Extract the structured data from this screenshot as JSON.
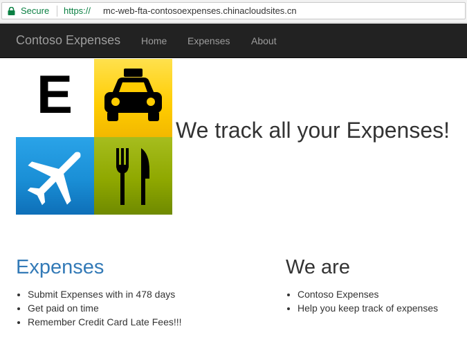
{
  "browser": {
    "secure_label": "Secure",
    "url_scheme": "https://",
    "url_host": "mc-web-fta-contosoexpenses.chinacloudsites.cn",
    "secure_color": "#0b8043"
  },
  "navbar": {
    "brand": "Contoso Expenses",
    "links": [
      {
        "label": "Home"
      },
      {
        "label": "Expenses"
      },
      {
        "label": "About"
      }
    ],
    "background": "#222222"
  },
  "hero": {
    "logo_letter": "E",
    "tiles": [
      {
        "icon": "letter-e-icon",
        "color": "#ffffff"
      },
      {
        "icon": "taxi-icon",
        "color": "#ffcc00"
      },
      {
        "icon": "airplane-icon",
        "color": "#1a8fd6"
      },
      {
        "icon": "fork-knife-icon",
        "color": "#8fa800"
      }
    ],
    "title": "We track all your Expenses!"
  },
  "sections": {
    "expenses": {
      "heading": "Expenses",
      "heading_color": "#337ab7",
      "items": [
        "Submit Expenses with in 478 days",
        "Get paid on time",
        "Remember Credit Card Late Fees!!!"
      ]
    },
    "we_are": {
      "heading": "We are",
      "heading_color": "#333333",
      "items": [
        "Contoso Expenses",
        "Help you keep track of expenses"
      ]
    }
  }
}
